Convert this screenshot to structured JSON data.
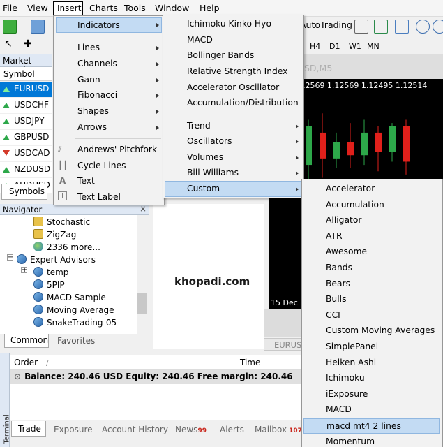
{
  "menubar": {
    "items": [
      "File",
      "View",
      "Insert",
      "Charts",
      "Tools",
      "Window",
      "Help"
    ]
  },
  "toolbar": {
    "autotrading_label": "AutoTrading",
    "timeframes": [
      "H4",
      "D1",
      "W1",
      "MN"
    ]
  },
  "market_watch": {
    "title": "Market Watch",
    "column": "Symbol",
    "symbols": [
      {
        "name": "EURUSD",
        "dir": "up",
        "selected": true
      },
      {
        "name": "USDCHF",
        "dir": "up",
        "selected": false
      },
      {
        "name": "USDJPY",
        "dir": "up",
        "selected": false
      },
      {
        "name": "GBPUSD",
        "dir": "up",
        "selected": false
      },
      {
        "name": "USDCAD",
        "dir": "down",
        "selected": false
      },
      {
        "name": "NZDUSD",
        "dir": "up",
        "selected": false
      },
      {
        "name": "AUDUSD",
        "dir": "up",
        "selected": false
      }
    ],
    "tab": "Symbols"
  },
  "navigator": {
    "title": "Navigator",
    "close": "×",
    "items": [
      {
        "label": "Stochastic",
        "type": "indicator"
      },
      {
        "label": "ZigZag",
        "type": "indicator"
      },
      {
        "label": "2336 more...",
        "type": "globe"
      },
      {
        "label": "Expert Advisors",
        "type": "folder"
      },
      {
        "label": "temp",
        "type": "ea"
      },
      {
        "label": "5PIP",
        "type": "ea"
      },
      {
        "label": "MACD Sample",
        "type": "ea"
      },
      {
        "label": "Moving Average",
        "type": "ea"
      },
      {
        "label": "SnakeTrading-05",
        "type": "ea"
      }
    ],
    "tabs": [
      "Common",
      "Favorites"
    ]
  },
  "watermark": "khopadi.com",
  "chart": {
    "title": "SD,M5",
    "info": "D,M5  1.12569 1.12569 1.12495 1.12514",
    "date_label": "15 Dec 20",
    "tab": "EURUS"
  },
  "terminal": {
    "label": "Terminal",
    "columns": {
      "order": "Order",
      "sort": "/",
      "time": "Time"
    },
    "balance": "Balance: 240.46 USD  Equity: 240.46  Free margin: 240.46",
    "tabs": [
      {
        "label": "Trade"
      },
      {
        "label": "Exposure"
      },
      {
        "label": "Account History"
      },
      {
        "label": "News",
        "badge": "99"
      },
      {
        "label": "Alerts"
      },
      {
        "label": "Mailbox",
        "badge": "107"
      }
    ]
  },
  "insert_menu": {
    "items": [
      "Indicators",
      "Lines",
      "Channels",
      "Gann",
      "Fibonacci",
      "Shapes",
      "Arrows",
      "Andrews' Pitchfork",
      "Cycle Lines",
      "Text",
      "Text Label"
    ]
  },
  "indicators_menu": {
    "items": [
      "Ichimoku Kinko Hyo",
      "MACD",
      "Bollinger Bands",
      "Relative Strength Index",
      "Accelerator Oscillator",
      "Accumulation/Distribution",
      "Trend",
      "Oscillators",
      "Volumes",
      "Bill Williams",
      "Custom"
    ]
  },
  "custom_menu": {
    "items": [
      "Accelerator",
      "Accumulation",
      "Alligator",
      "ATR",
      "Awesome",
      "Bands",
      "Bears",
      "Bulls",
      "CCI",
      "Custom Moving Averages",
      "SimplePanel",
      "Heiken Ashi",
      "Ichimoku",
      "iExposure",
      "MACD",
      "macd mt4 2 lines",
      "Momentum"
    ]
  },
  "colors": {
    "selection": "#0078d7",
    "highlight": "#c3dbf3",
    "bull": "#2da84a",
    "bear": "#e0201b"
  },
  "candles": [
    {
      "o": 1.1251,
      "c": 1.1257,
      "h": 1.1258,
      "l": 1.1248
    },
    {
      "o": 1.1256,
      "c": 1.1252,
      "h": 1.1259,
      "l": 1.1249
    },
    {
      "o": 1.1252,
      "c": 1.12545,
      "h": 1.1256,
      "l": 1.12505
    },
    {
      "o": 1.12545,
      "c": 1.12525,
      "h": 1.12575,
      "l": 1.12505
    },
    {
      "o": 1.12525,
      "c": 1.1256,
      "h": 1.1258,
      "l": 1.1251
    },
    {
      "o": 1.1256,
      "c": 1.1253,
      "h": 1.1257,
      "l": 1.125
    },
    {
      "o": 1.1253,
      "c": 1.1257,
      "h": 1.12575,
      "l": 1.12515
    },
    {
      "o": 1.1257,
      "c": 1.12515,
      "h": 1.1258,
      "l": 1.12495
    }
  ]
}
